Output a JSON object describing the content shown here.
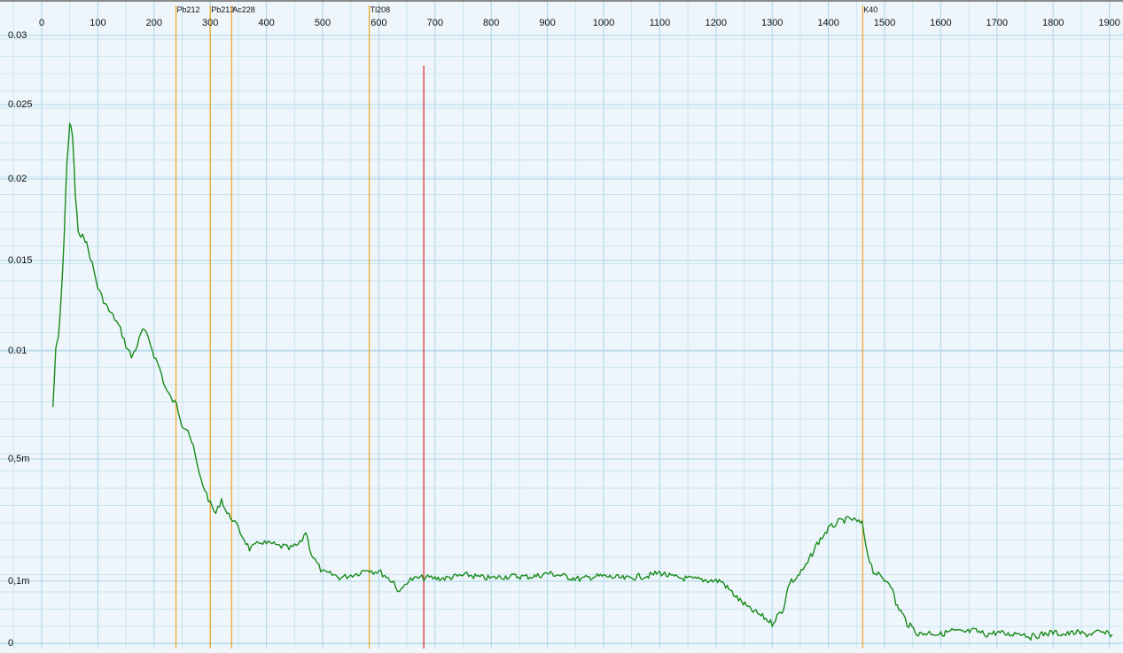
{
  "chart_data": {
    "type": "line",
    "title": "",
    "xlabel": "",
    "ylabel": "",
    "xlim": [
      -52,
      1905
    ],
    "y_scale": "log-like (compressed near zero)",
    "grid": true,
    "x_ticks": [
      {
        "value": 0,
        "label": "0"
      },
      {
        "value": 100,
        "label": "100"
      },
      {
        "value": 200,
        "label": "200"
      },
      {
        "value": 300,
        "label": "300"
      },
      {
        "value": 400,
        "label": "400"
      },
      {
        "value": 500,
        "label": "500"
      },
      {
        "value": 600,
        "label": "600"
      },
      {
        "value": 700,
        "label": "700"
      },
      {
        "value": 800,
        "label": "800"
      },
      {
        "value": 900,
        "label": "900"
      },
      {
        "value": 1000,
        "label": "1000"
      },
      {
        "value": 1100,
        "label": "1100"
      },
      {
        "value": 1200,
        "label": "1200"
      },
      {
        "value": 1300,
        "label": "1300"
      },
      {
        "value": 1400,
        "label": "1400"
      },
      {
        "value": 1500,
        "label": "1500"
      },
      {
        "value": 1600,
        "label": "1600"
      },
      {
        "value": 1700,
        "label": "1700"
      },
      {
        "value": 1800,
        "label": "1800"
      },
      {
        "value": 1900,
        "label": "1900"
      }
    ],
    "y_ticks": [
      {
        "value": 0.03,
        "label": "0.03"
      },
      {
        "value": 0.025,
        "label": "0.025"
      },
      {
        "value": 0.02,
        "label": "0.02"
      },
      {
        "value": 0.015,
        "label": "0.015"
      },
      {
        "value": 0.01,
        "label": "0.01"
      },
      {
        "value": 0.005,
        "label": "0,5m"
      },
      {
        "value": 0.0001,
        "label": "0,1m"
      },
      {
        "value": 0,
        "label": "0"
      }
    ],
    "markers": [
      {
        "label": "Pb212",
        "x": 239,
        "color": "#f0a020"
      },
      {
        "label": "Pb212",
        "x": 300,
        "color": "#f0a020"
      },
      {
        "label": "Ac228",
        "x": 338,
        "color": "#f0a020"
      },
      {
        "label": "Tl208",
        "x": 583,
        "color": "#f0a020"
      },
      {
        "label": "K40",
        "x": 1461,
        "color": "#f0a020"
      }
    ],
    "cursor": {
      "x": 680,
      "color": "#dd2222"
    },
    "series": [
      {
        "color": "#1a8a1a",
        "x": [
          20,
          25,
          30,
          35,
          40,
          45,
          50,
          55,
          60,
          65,
          70,
          75,
          80,
          90,
          100,
          110,
          120,
          130,
          140,
          150,
          160,
          170,
          180,
          190,
          200,
          210,
          220,
          230,
          240,
          250,
          260,
          270,
          280,
          290,
          300,
          310,
          320,
          330,
          340,
          350,
          360,
          370,
          380,
          390,
          400,
          410,
          420,
          430,
          440,
          450,
          460,
          470,
          480,
          490,
          500,
          510,
          520,
          530,
          540,
          550,
          560,
          570,
          580,
          590,
          600,
          610,
          620,
          630,
          640,
          650,
          660,
          670,
          680,
          690,
          700,
          720,
          740,
          760,
          780,
          800,
          820,
          840,
          860,
          880,
          900,
          920,
          940,
          960,
          980,
          1000,
          1020,
          1040,
          1060,
          1080,
          1100,
          1120,
          1140,
          1160,
          1180,
          1200,
          1220,
          1240,
          1260,
          1280,
          1300,
          1320,
          1340,
          1360,
          1380,
          1400,
          1420,
          1440,
          1460,
          1470,
          1480,
          1500,
          1520,
          1540,
          1560,
          1580,
          1600,
          1620,
          1640,
          1660,
          1680,
          1700,
          1720,
          1740,
          1760,
          1780,
          1800,
          1820,
          1840,
          1860,
          1880,
          1905
        ],
        "y": [
          0.0074,
          0.01,
          0.0108,
          0.013,
          0.0165,
          0.021,
          0.0238,
          0.0228,
          0.019,
          0.0168,
          0.0163,
          0.0166,
          0.016,
          0.0148,
          0.0135,
          0.0128,
          0.0122,
          0.0118,
          0.0112,
          0.0103,
          0.0097,
          0.0103,
          0.0112,
          0.0107,
          0.0098,
          0.0092,
          0.0083,
          0.0078,
          0.0075,
          0.0066,
          0.0064,
          0.0055,
          0.0044,
          0.0038,
          0.0032,
          0.0028,
          0.0034,
          0.0028,
          0.0026,
          0.0022,
          0.0018,
          0.0014,
          0.0015,
          0.0017,
          0.0016,
          0.0016,
          0.0015,
          0.0015,
          0.0014,
          0.0015,
          0.0016,
          0.0021,
          0.0012,
          0.0008,
          0.00045,
          0.0004,
          0.00035,
          0.00025,
          0.00028,
          0.00035,
          0.0004,
          0.0005,
          0.0006,
          0.0005,
          0.0005,
          0.00035,
          0.00015,
          8e-05,
          7e-05,
          0.0001,
          0.00018,
          0.00022,
          0.00024,
          0.00024,
          0.00022,
          0.00022,
          0.0003,
          0.00035,
          0.00025,
          0.00022,
          0.00028,
          0.0003,
          0.00028,
          0.0003,
          0.00042,
          0.00035,
          0.00025,
          0.00018,
          0.00028,
          0.0003,
          0.00025,
          0.0002,
          0.00028,
          0.00032,
          0.00045,
          0.00028,
          0.00022,
          0.00018,
          0.00015,
          0.00012,
          8e-05,
          5e-05,
          3e-05,
          2e-05,
          1e-05,
          3e-05,
          0.00015,
          0.0007,
          0.0016,
          0.0022,
          0.0025,
          0.0026,
          0.0024,
          0.0012,
          0.0005,
          0.00015,
          4e-05,
          1e-05,
          2e-06,
          3e-06,
          2e-06,
          4e-06,
          3e-06,
          4e-06,
          2e-06,
          3e-06,
          2e-06,
          3e-06,
          1e-06,
          2e-06,
          3e-06,
          2e-06,
          3e-06,
          2e-06,
          3e-06,
          2e-06
        ]
      }
    ]
  }
}
